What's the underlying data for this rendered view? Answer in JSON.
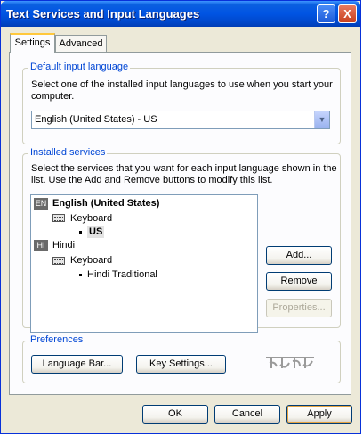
{
  "window": {
    "title": "Text Services and Input Languages",
    "help_label": "?",
    "close_label": "X"
  },
  "tabs": [
    {
      "label": "Settings",
      "active": true
    },
    {
      "label": "Advanced",
      "active": false
    }
  ],
  "default_language": {
    "group_label": "Default input language",
    "description_line1": "Select one of the installed input languages to use when you start your",
    "description_line2": "computer.",
    "selected_value": "English (United States) - US"
  },
  "installed_services": {
    "group_label": "Installed services",
    "description_line1": "Select the services that you want for each input language shown in the",
    "description_line2": "list. Use the Add and Remove buttons to modify this list.",
    "languages": [
      {
        "badge": "EN",
        "name": "English (United States)",
        "service_type": "Keyboard",
        "layout": "US"
      },
      {
        "badge": "HI",
        "name": "Hindi",
        "service_type": "Keyboard",
        "layout": "Hindi Traditional"
      }
    ],
    "add_label": "Add...",
    "remove_label": "Remove",
    "properties_label": "Properties..."
  },
  "preferences": {
    "group_label": "Preferences",
    "language_bar_label": "Language Bar...",
    "key_settings_label": "Key Settings..."
  },
  "footer": {
    "ok_label": "OK",
    "cancel_label": "Cancel",
    "apply_label": "Apply"
  }
}
